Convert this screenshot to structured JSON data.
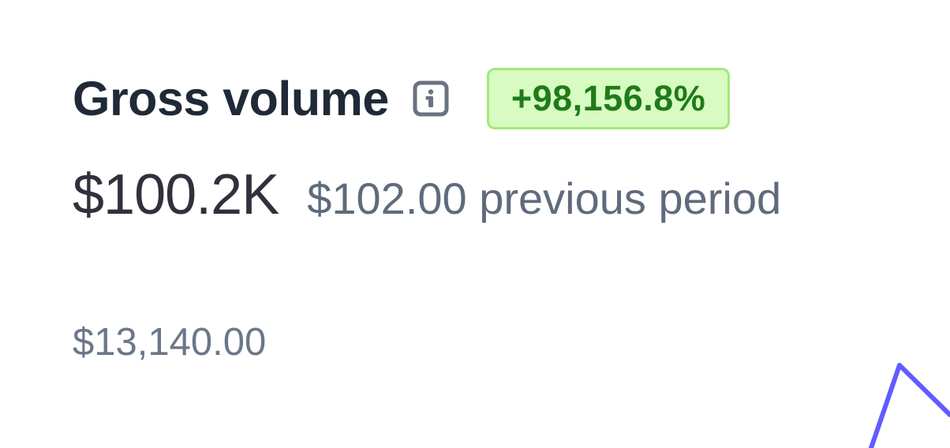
{
  "metric": {
    "title": "Gross volume",
    "info_icon": "info-icon",
    "change_badge": "+98,156.8%",
    "current_value": "$100.2K",
    "previous_value": "$102.00 previous period"
  },
  "chart": {
    "y_max_label": "$13,140.00",
    "line_color": "#635bff"
  },
  "colors": {
    "badge_bg": "#d7fbc0",
    "badge_border": "#a3e87a",
    "badge_text": "#1f7a1a",
    "title": "#1f2937",
    "muted": "#5f6b7d"
  }
}
